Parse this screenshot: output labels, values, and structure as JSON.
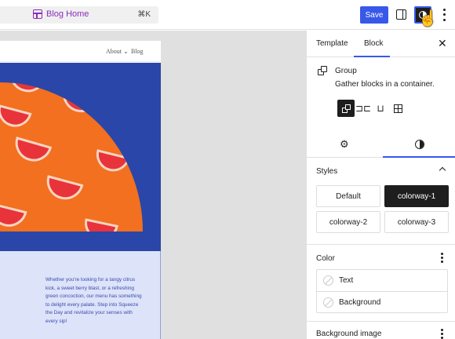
{
  "topbar": {
    "command_title": "Blog Home",
    "command_shortcut": "⌘K",
    "save_label": "Save"
  },
  "site": {
    "nav": [
      "About ⌄",
      "Blog"
    ],
    "body_text": "Whether you're looking for a tangy citrus kick, a sweet berry blast, or a refreshing green concoction, our menu has something to delight every palate. Step into Squeeze the Day and revitalize your senses with every sip!"
  },
  "colors": {
    "accent": "#3858e9",
    "brand_purple": "#8d2bbf",
    "hero_blue": "#2a46a8",
    "hero_orange": "#f2701f",
    "grapefruit": "#e8333a"
  },
  "inspector": {
    "tabs": [
      "Template",
      "Block"
    ],
    "active_tab": "Block",
    "block": {
      "name": "Group",
      "description": "Gather blocks in a container.",
      "variation_icons": [
        "group-icon",
        "row-icon",
        "stack-icon",
        "grid-icon"
      ]
    },
    "subtab_icons": [
      "gear-icon",
      "contrast-icon"
    ],
    "styles": {
      "title": "Styles",
      "options": [
        "Default",
        "colorway-1",
        "colorway-2",
        "colorway-3"
      ],
      "selected": "colorway-1"
    },
    "color": {
      "title": "Color",
      "items": [
        "Text",
        "Background"
      ]
    },
    "background_image": {
      "title": "Background image"
    }
  }
}
